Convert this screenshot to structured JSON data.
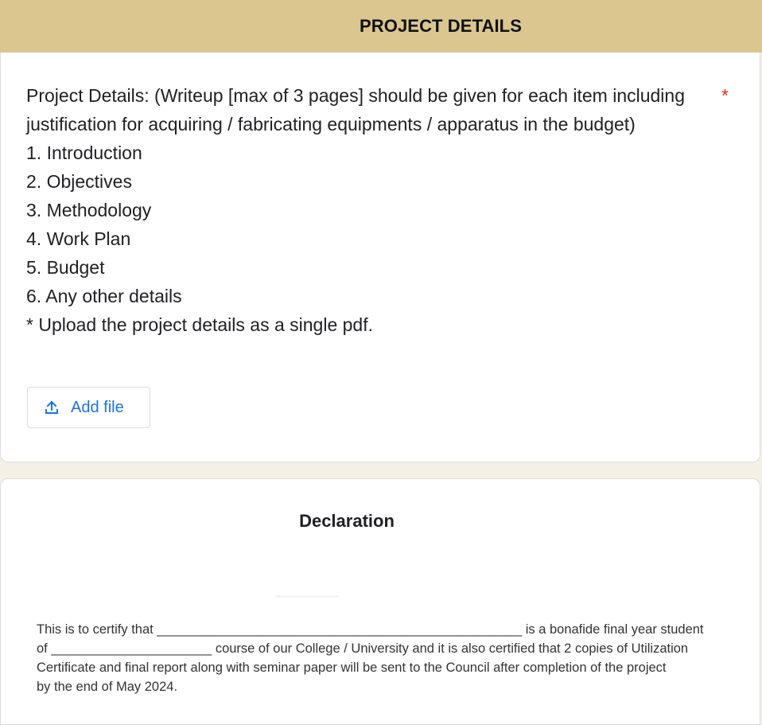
{
  "header": {
    "title": "PROJECT DETAILS"
  },
  "question": {
    "lines": [
      "Project Details: (Writeup [max of 3 pages] should be given for each item including",
      "justification for acquiring / fabricating equipments / apparatus in the budget)",
      "1. Introduction",
      "2. Objectives",
      "3. Methodology",
      "4. Work Plan",
      "5. Budget",
      "6. Any other details",
      "* Upload the project details as a single pdf."
    ],
    "required_marker": "*",
    "required_color": "#d93025"
  },
  "upload": {
    "button_label": "Add file",
    "icon": "upload-icon",
    "accent_color": "#1a73e8"
  },
  "declaration": {
    "title": "Declaration",
    "lines": [
      "This is to certify that __________________________________________________ is a bonafide final year student",
      "of ______________________  course of our College / University and it is also certified that 2 copies of Utilization",
      "Certificate and final report along with seminar paper will be sent to  the Council after completion of the project",
      "by the end of May 2024."
    ]
  },
  "colors": {
    "header_band": "#dbc690",
    "page_background": "#f5f0e6",
    "card_background": "#ffffff"
  }
}
